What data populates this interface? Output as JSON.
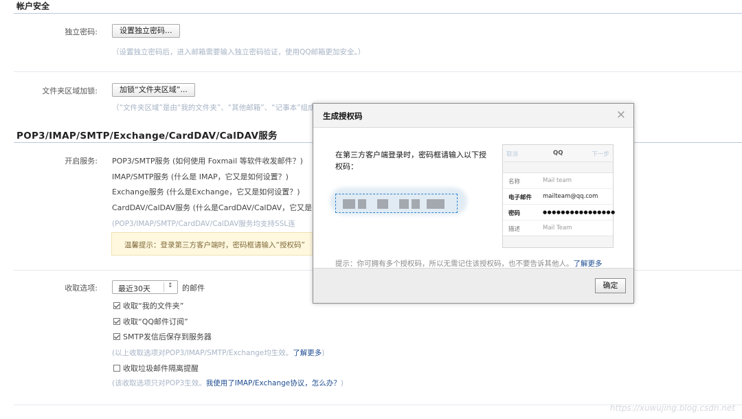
{
  "account_security": {
    "title": "帐户安全",
    "independent_password": {
      "label": "独立密码:",
      "button": "设置独立密码...",
      "hint": "（设置独立密码后，进入邮箱需要输入独立密码验证，使用QQ邮箱更加安全。）"
    },
    "folder_area": {
      "label": "文件夹区域加锁:",
      "button": "加锁“文件夹区域”...",
      "hint": "（“文件夹区域”是由“我的文件夹”、“其他邮箱”、“记事本”组成"
    }
  },
  "services": {
    "title": "POP3/IMAP/SMTP/Exchange/CardDAV/CalDAV服务",
    "label": "开启服务:",
    "items": [
      "POP3/SMTP服务 (如何使用 Foxmail 等软件收发邮件？)",
      "IMAP/SMTP服务 (什么是 IMAP，它又是如何设置？)",
      "Exchange服务 (什么是Exchange，它又是如何设置？)",
      "CardDAV/CalDAV服务 (什么是CardDAV/CalDAV，它又是"
    ],
    "ssl_hint": "(POP3/IMAP/SMTP/CardDAV/CalDAV服务均支持SSL连",
    "warm_tip": "温馨提示：登录第三方客户端时，密码框请输入“授权码”"
  },
  "receive": {
    "label": "收取选项:",
    "select_value": "最近30天",
    "select_suffix": "的邮件",
    "checkboxes": [
      {
        "label": "收取“我的文件夹”",
        "checked": true
      },
      {
        "label": "收取“QQ邮件订阅”",
        "checked": true
      },
      {
        "label": "SMTP发信后保存到服务器",
        "checked": true
      }
    ],
    "hint1_text": "(以上收取选项对POP3/IMAP/SMTP/Exchange均生效。",
    "hint1_link": "了解更多",
    "hint1_close": ")",
    "spam_checkbox": {
      "label": "收取垃圾邮件隔离提醒",
      "checked": false
    },
    "hint2_text": "(该收取选项只对POP3生效。",
    "hint2_link": "我使用了IMAP/Exchange协议，怎么办？",
    "hint2_close": ")"
  },
  "modal": {
    "title": "生成授权码",
    "close_glyph": "×",
    "close_icon": "close-icon",
    "instruction": "在第三方客户端登录时，密码框请输入以下授权码：",
    "note_text": "提示：你可拥有多个授权码，所以无需记住该授权码，也不要告诉其他人。",
    "note_link": "了解更多",
    "confirm": "确定",
    "phone": {
      "cancel": "取消",
      "title": "QQ",
      "next": "下一步",
      "rows": [
        {
          "key": "名称",
          "value": "Mail team"
        },
        {
          "key": "电子邮件",
          "value": "mailteam@qq.com"
        },
        {
          "key": "密码",
          "value": "●●●●●●●●●●●●●●●●"
        },
        {
          "key": "描述",
          "value": "Mail Team"
        }
      ]
    }
  },
  "watermark": "https://xuwujing.blog.csdn.net",
  "colors": {
    "accent_link": "#1d4c91",
    "rule": "#b9c8dc",
    "hint": "#a7b4c6",
    "tip_bg": "#fff8df"
  }
}
